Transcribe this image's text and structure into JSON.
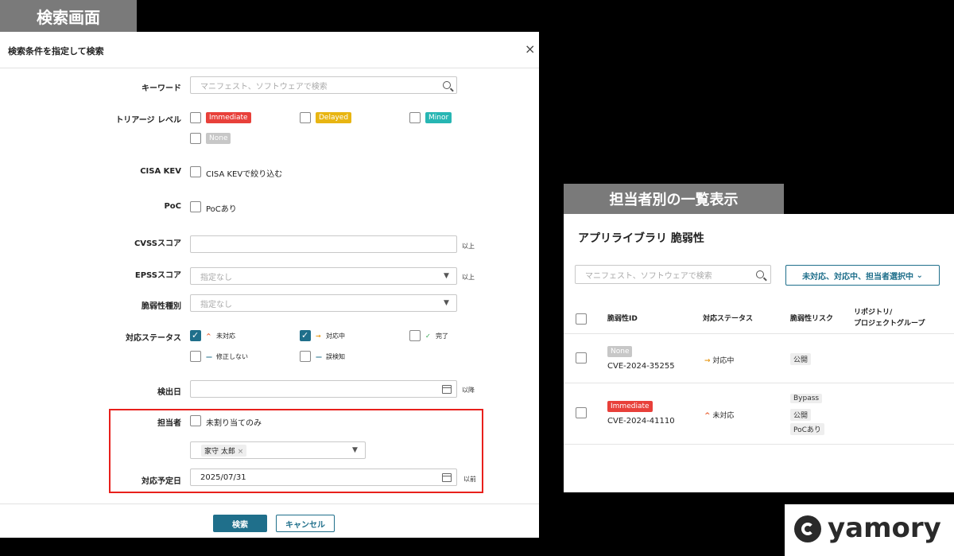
{
  "labels": {
    "search_screen": "検索画面",
    "list_view": "担当者別の一覧表示"
  },
  "modal": {
    "title": "検索条件を指定して検索",
    "close": "×",
    "keyword": {
      "label": "キーワード",
      "placeholder": "マニフェスト、ソフトウェアで検索"
    },
    "triage": {
      "label": "トリアージ レベル",
      "options": [
        "Immediate",
        "Delayed",
        "Minor",
        "None"
      ],
      "colors": {
        "immediate": "#e8403a",
        "delayed": "#e8b512",
        "minor": "#27b6b3",
        "none": "#c7c7c7"
      }
    },
    "cisa_kev": {
      "label": "CISA KEV",
      "option": "CISA KEVで絞り込む"
    },
    "poc": {
      "label": "PoC",
      "option": "PoCあり"
    },
    "cvss": {
      "label": "CVSSスコア",
      "suffix": "以上"
    },
    "epss": {
      "label": "EPSSスコア",
      "placeholder": "指定なし",
      "suffix": "以上"
    },
    "vuln_type": {
      "label": "脆弱性種別",
      "placeholder": "指定なし"
    },
    "status": {
      "label": "対応ステータス",
      "options": [
        {
          "text": "未対応",
          "icon": "^",
          "checked": true
        },
        {
          "text": "対応中",
          "icon": "→",
          "checked": true
        },
        {
          "text": "完了",
          "icon": "✓",
          "checked": false
        },
        {
          "text": "修正しない",
          "icon": "—",
          "checked": false
        },
        {
          "text": "誤検知",
          "icon": "—",
          "checked": false
        }
      ]
    },
    "detected": {
      "label": "検出日",
      "suffix": "以降"
    },
    "assignee": {
      "label": "担当者",
      "option": "未割り当てのみ",
      "selected": "家守 太郎",
      "remove": "×"
    },
    "due": {
      "label": "対応予定日",
      "value": "2025/07/31",
      "suffix": "以前"
    },
    "buttons": {
      "search": "検索",
      "cancel": "キャンセル"
    }
  },
  "panel": {
    "title": "アプリライブラリ 脆弱性",
    "search_placeholder": "マニフェスト、ソフトウェアで検索",
    "filter": "未対応、対応中、担当者選択中",
    "columns": [
      "脆弱性ID",
      "対応ステータス",
      "脆弱性リスク",
      "リポジトリ/",
      "プロジェクトグループ"
    ],
    "rows": [
      {
        "badge": "None",
        "id": "CVE-2024-35255",
        "status": "対応中",
        "status_icon": "→",
        "risks": [
          "公開"
        ]
      },
      {
        "badge": "Immediate",
        "id": "CVE-2024-41110",
        "status": "未対応",
        "status_icon": "^",
        "risks": [
          "Bypass",
          "公開",
          "PoCあり"
        ]
      }
    ]
  },
  "logo": {
    "text": "yamory"
  }
}
